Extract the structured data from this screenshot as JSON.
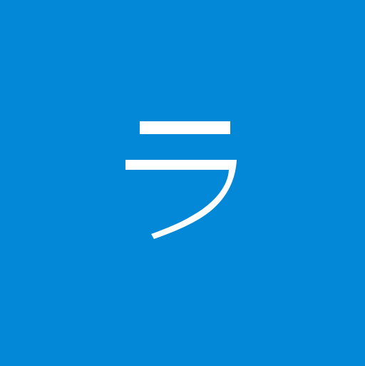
{
  "avatar": {
    "initial": "ラ",
    "background_color": "#0388D8",
    "text_color": "#FFFFFF"
  }
}
